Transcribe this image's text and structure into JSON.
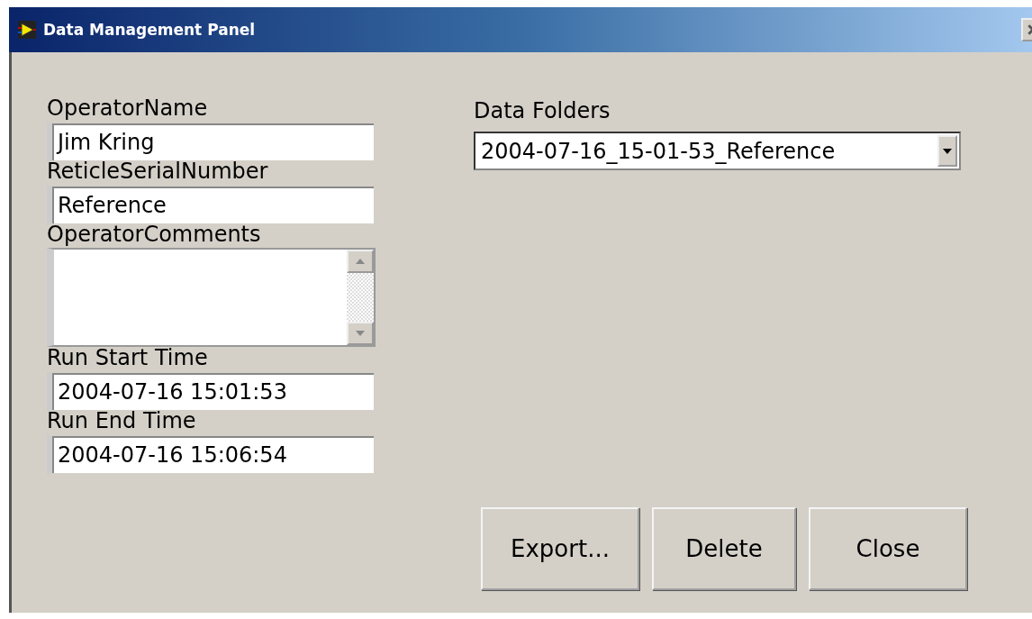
{
  "window": {
    "title": "Data Management Panel"
  },
  "fields": [
    {
      "kind": "text",
      "label": "OperatorName",
      "value": "Jim Kring"
    },
    {
      "kind": "text",
      "label": "ReticleSerialNumber",
      "value": "Reference"
    },
    {
      "kind": "textarea",
      "label": "OperatorComments"
    },
    {
      "kind": "text",
      "label": "Run Start Time",
      "value": "2004-07-16 15:01:53"
    },
    {
      "kind": "text",
      "label": "Run End Time",
      "value": "2004-07-16 15:06:54"
    }
  ],
  "data_folders": {
    "label": "Data Folders",
    "value": "2004-07-16_15-01-53_Reference"
  },
  "buttons": [
    "Export...",
    "Delete",
    "Close"
  ]
}
